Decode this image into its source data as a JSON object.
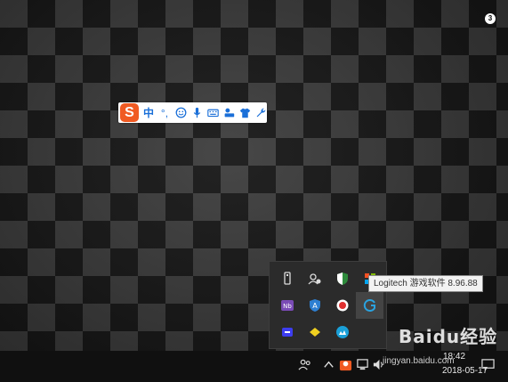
{
  "ime_toolbar": {
    "logo": "S",
    "mode": "中",
    "punct": "°,",
    "icons": [
      "smiley-icon",
      "microphone-icon",
      "keyboard-icon",
      "toolbox-icon",
      "shirt-icon",
      "wrench-icon"
    ]
  },
  "tray": {
    "icons": [
      [
        "usb-drive-icon",
        "network-user-icon",
        "shield-icon",
        "colorful-grid-icon"
      ],
      [
        "nvidia-icon",
        "defender-a-icon",
        "record-icon",
        "logitech-g-icon"
      ],
      [
        "keyboard-app-icon",
        "yellow-diamond-icon",
        "cloud-icon"
      ]
    ],
    "tooltip": "Logitech 游戏软件 8.96.88"
  },
  "taskbar": {
    "time": "18:42",
    "date": "2018-05-17",
    "notification_count": "3"
  },
  "watermark": {
    "logo": "Baidu经验",
    "url": "jingyan.baidu.com"
  },
  "colors": {
    "ime_accent": "#f05a22",
    "ime_icon": "#1a6fd8",
    "taskbar": "#101010"
  }
}
